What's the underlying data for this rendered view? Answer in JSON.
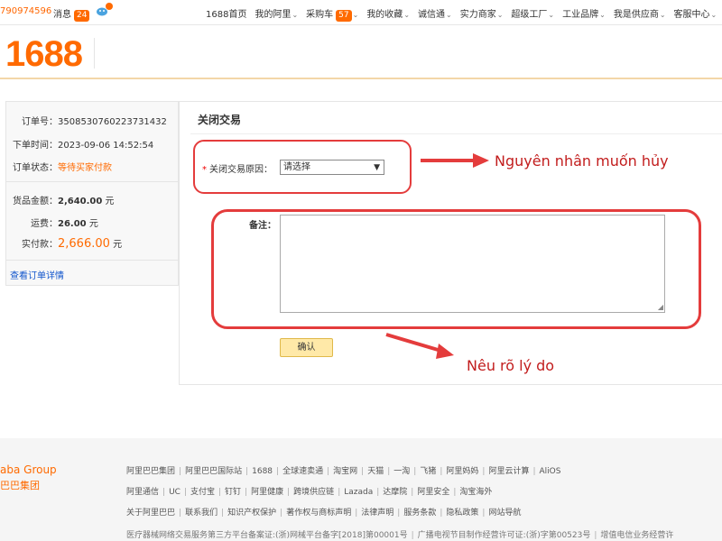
{
  "topbar": {
    "user_id": "790974596",
    "messages_label": "消息",
    "messages_count": "24",
    "bell_badge": "1",
    "nav": [
      {
        "label": "1688首页",
        "caret": false
      },
      {
        "label": "我的阿里",
        "caret": true
      },
      {
        "label": "采购车",
        "badge": "57",
        "caret": true
      },
      {
        "label": "我的收藏",
        "caret": true
      },
      {
        "label": "诚信通",
        "caret": true
      },
      {
        "label": "实力商家",
        "caret": true
      },
      {
        "label": "超级工厂",
        "caret": true
      },
      {
        "label": "工业品牌",
        "caret": true
      },
      {
        "label": "我是供应商",
        "caret": true
      },
      {
        "label": "客服中心",
        "caret": true
      }
    ]
  },
  "header": {
    "logo_text": "1688"
  },
  "order": {
    "order_no_label": "订单号：",
    "order_no": "3508530760223731432",
    "time_label": "下单时间：",
    "time": "2023-09-06 14:52:54",
    "status_label": "订单状态：",
    "status": "等待买家付款",
    "goods_label": "货品金额：",
    "goods_amount": "2,640.00",
    "goods_unit": "元",
    "shipping_label": "运费：",
    "shipping_amount": "26.00",
    "shipping_unit": "元",
    "paid_label": "实付款：",
    "paid_amount": "2,666.00",
    "paid_unit": "元",
    "detail_link": "查看订单详情"
  },
  "form": {
    "title": "关闭交易",
    "required_mark": "*",
    "reason_label": "关闭交易原因：",
    "reason_selected": "请选择",
    "note_label": "备注：",
    "confirm_label": "确认"
  },
  "annotations": {
    "reason_note": "Nguyên nhân muốn hủy",
    "detail_note": "Nêu rõ lý do",
    "color": "#e43c3c"
  },
  "footer": {
    "logo_line1": "aba Group",
    "logo_line2": "巴巴集团",
    "row1": [
      "阿里巴巴集团",
      "阿里巴巴国际站",
      "1688",
      "全球速卖通",
      "淘宝网",
      "天猫",
      "一淘",
      "飞猪",
      "阿里妈妈",
      "阿里云计算",
      "AliOS"
    ],
    "row2": [
      "阿里通信",
      "UC",
      "支付宝",
      "钉钉",
      "阿里健康",
      "跨境供应链",
      "Lazada",
      "达摩院",
      "阿里安全",
      "淘宝海外"
    ],
    "row3": [
      "关于阿里巴巴",
      "联系我们",
      "知识产权保护",
      "著作权与商标声明",
      "法律声明",
      "服务条款",
      "隐私政策",
      "网站导航"
    ],
    "row4": [
      "医疗器械网络交易服务第三方平台备案证:(浙)网械平台备字[2018]第00001号",
      "广播电视节目制作经营许可证:(浙)字第00523号",
      "增值电信业务经营许"
    ]
  }
}
